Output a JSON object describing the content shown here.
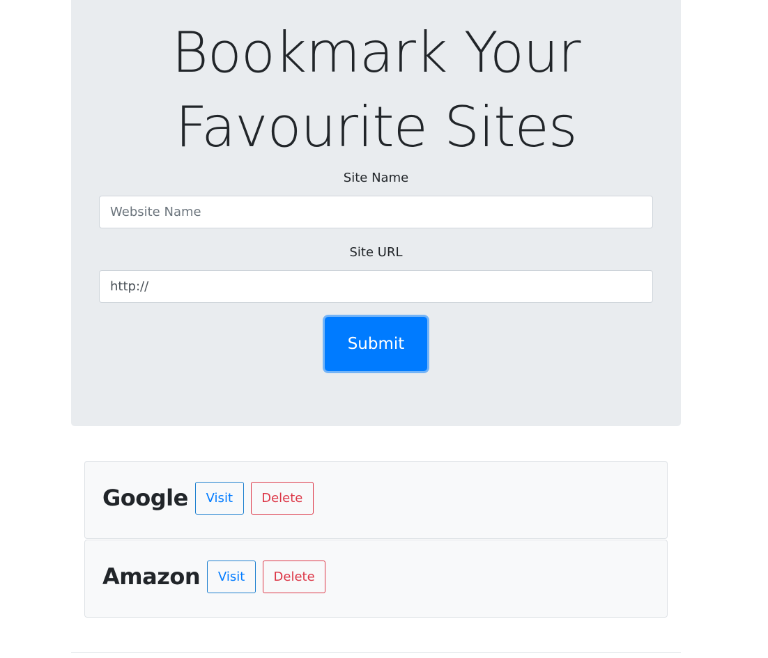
{
  "header": {
    "title": "Bookmark Your Favourite Sites"
  },
  "form": {
    "site_name_label": "Site Name",
    "site_name_placeholder": "Website Name",
    "site_name_value": "",
    "site_url_label": "Site URL",
    "site_url_value": "http://",
    "submit_label": "Submit"
  },
  "bookmarks": [
    {
      "name": "Google",
      "visit_label": "Visit",
      "delete_label": "Delete"
    },
    {
      "name": "Amazon",
      "visit_label": "Visit",
      "delete_label": "Delete"
    }
  ],
  "colors": {
    "primary": "#007bff",
    "danger": "#dc3545",
    "jumbotron_bg": "#e9ecef",
    "card_bg": "#f8f9fa"
  }
}
